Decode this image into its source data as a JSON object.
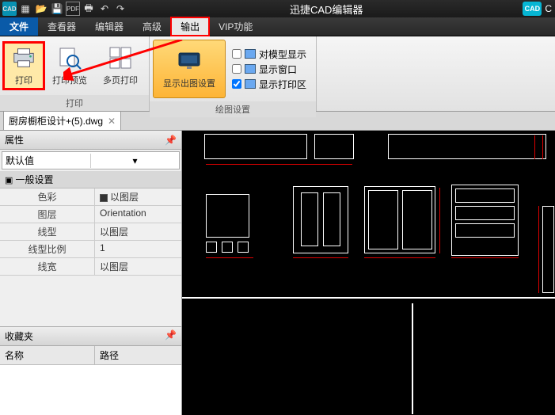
{
  "title": "迅捷CAD编辑器",
  "toolbar_icons": [
    "cad",
    "new",
    "open",
    "save",
    "pdf",
    "print",
    "undo",
    "redo"
  ],
  "menu": {
    "file": "文件",
    "viewer": "查看器",
    "editor": "编辑器",
    "advanced": "高级",
    "output": "输出",
    "vip": "VIP功能"
  },
  "ribbon": {
    "print": "打印",
    "print_preview": "打印预览",
    "multi_print": "多页打印",
    "group_print": "打印",
    "display_settings": "显示出图设置",
    "chk_model": "对模型显示",
    "chk_window": "显示窗口",
    "chk_area": "显示打印区",
    "group_draw": "绘图设置"
  },
  "doc_tab": "厨房橱柜设计+(5).dwg",
  "props": {
    "title": "属性",
    "default": "默认值",
    "section": "一般设置",
    "rows": [
      {
        "k": "色彩",
        "v": "以图层",
        "chk": true
      },
      {
        "k": "图层",
        "v": "Orientation"
      },
      {
        "k": "线型",
        "v": "以图层"
      },
      {
        "k": "线型比例",
        "v": "1"
      },
      {
        "k": "线宽",
        "v": "以图层"
      }
    ]
  },
  "fav": {
    "title": "收藏夹",
    "col1": "名称",
    "col2": "路径"
  },
  "brand_suffix": "C"
}
